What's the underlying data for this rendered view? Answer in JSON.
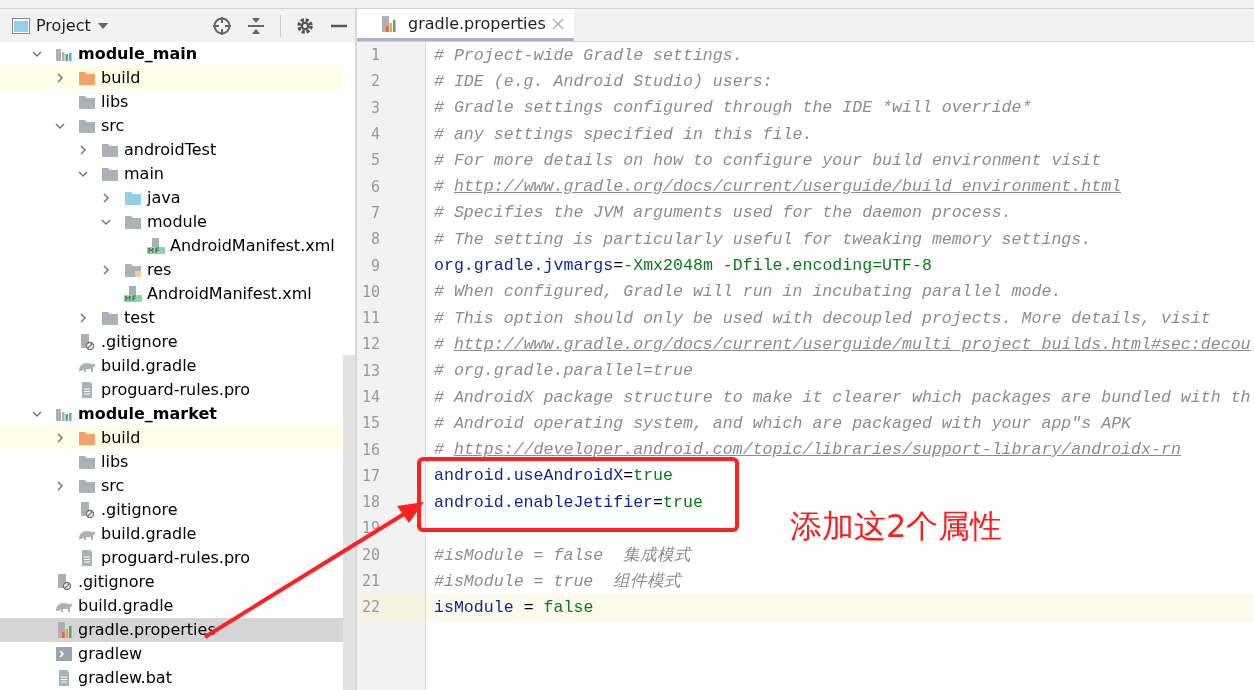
{
  "project_panel": {
    "title": "Project",
    "tree": [
      {
        "label": "module_main",
        "kind": "module",
        "expanded": true,
        "selected": false,
        "children": [
          {
            "label": "build",
            "kind": "excluded-folder",
            "expanded": false,
            "selected": false
          },
          {
            "label": "libs",
            "kind": "folder",
            "selected": false
          },
          {
            "label": "src",
            "kind": "folder",
            "expanded": true,
            "selected": false,
            "children": [
              {
                "label": "androidTest",
                "kind": "folder",
                "expanded": false,
                "selected": false
              },
              {
                "label": "main",
                "kind": "folder",
                "expanded": true,
                "selected": false,
                "children": [
                  {
                    "label": "java",
                    "kind": "source-folder",
                    "expanded": false,
                    "selected": false
                  },
                  {
                    "label": "module",
                    "kind": "folder",
                    "expanded": true,
                    "selected": false,
                    "children": [
                      {
                        "label": "AndroidManifest.xml",
                        "kind": "manifest",
                        "selected": false
                      }
                    ]
                  },
                  {
                    "label": "res",
                    "kind": "res-folder",
                    "expanded": false,
                    "selected": false
                  },
                  {
                    "label": "AndroidManifest.xml",
                    "kind": "manifest",
                    "selected": false
                  }
                ]
              },
              {
                "label": "test",
                "kind": "folder",
                "expanded": false,
                "selected": false
              }
            ]
          },
          {
            "label": ".gitignore",
            "kind": "gitignore",
            "selected": false
          },
          {
            "label": "build.gradle",
            "kind": "gradle",
            "selected": false
          },
          {
            "label": "proguard-rules.pro",
            "kind": "text-file",
            "selected": false
          }
        ]
      },
      {
        "label": "module_market",
        "kind": "module",
        "expanded": true,
        "selected": false,
        "children": [
          {
            "label": "build",
            "kind": "excluded-folder",
            "expanded": false,
            "selected": false
          },
          {
            "label": "libs",
            "kind": "folder",
            "selected": false
          },
          {
            "label": "src",
            "kind": "folder",
            "expanded": false,
            "selected": false
          },
          {
            "label": ".gitignore",
            "kind": "gitignore",
            "selected": false
          },
          {
            "label": "build.gradle",
            "kind": "gradle",
            "selected": false
          },
          {
            "label": "proguard-rules.pro",
            "kind": "text-file",
            "selected": false
          }
        ]
      },
      {
        "label": ".gitignore",
        "kind": "gitignore",
        "selected": false
      },
      {
        "label": "build.gradle",
        "kind": "gradle",
        "selected": false
      },
      {
        "label": "gradle.properties",
        "kind": "properties",
        "selected": true
      },
      {
        "label": "gradlew",
        "kind": "shell",
        "selected": false
      },
      {
        "label": "gradlew.bat",
        "kind": "text-file",
        "selected": false
      }
    ]
  },
  "tabs": [
    {
      "label": "gradle.properties",
      "selected": true
    }
  ],
  "editor": {
    "lines": [
      {
        "number": "1",
        "current": false,
        "segments": [
          {
            "kind": "comment",
            "text": "# Project-wide Gradle settings."
          }
        ]
      },
      {
        "number": "2",
        "current": false,
        "segments": [
          {
            "kind": "comment",
            "text": "# IDE (e.g. Android Studio) users:"
          }
        ]
      },
      {
        "number": "3",
        "current": false,
        "segments": [
          {
            "kind": "comment",
            "text": "# Gradle settings configured through the IDE *will override*"
          }
        ]
      },
      {
        "number": "4",
        "current": false,
        "segments": [
          {
            "kind": "comment",
            "text": "# any settings specified in this file."
          }
        ]
      },
      {
        "number": "5",
        "current": false,
        "segments": [
          {
            "kind": "comment",
            "text": "# For more details on how to configure your build environment visit"
          }
        ]
      },
      {
        "number": "6",
        "current": false,
        "segments": [
          {
            "kind": "comment",
            "text": "# "
          },
          {
            "kind": "link",
            "text": "http://www.gradle.org/docs/current/userguide/build_environment.html"
          }
        ]
      },
      {
        "number": "7",
        "current": false,
        "segments": [
          {
            "kind": "comment",
            "text": "# Specifies the JVM arguments used for the daemon process."
          }
        ]
      },
      {
        "number": "8",
        "current": false,
        "segments": [
          {
            "kind": "comment",
            "text": "# The setting is particularly useful for tweaking memory settings."
          }
        ]
      },
      {
        "number": "9",
        "current": false,
        "segments": [
          {
            "kind": "key",
            "text": "org.gradle.jvmargs"
          },
          {
            "kind": "plain",
            "text": "="
          },
          {
            "kind": "value",
            "text": "-Xmx2048m -Dfile.encoding=UTF-8"
          }
        ]
      },
      {
        "number": "10",
        "current": false,
        "segments": [
          {
            "kind": "comment",
            "text": "# When configured, Gradle will run in incubating parallel mode."
          }
        ]
      },
      {
        "number": "11",
        "current": false,
        "segments": [
          {
            "kind": "comment",
            "text": "# This option should only be used with decoupled projects. More details, visit"
          }
        ]
      },
      {
        "number": "12",
        "current": false,
        "segments": [
          {
            "kind": "comment",
            "text": "# "
          },
          {
            "kind": "link",
            "text": "http://www.gradle.org/docs/current/userguide/multi_project_builds.html#sec:decou"
          }
        ]
      },
      {
        "number": "13",
        "current": false,
        "segments": [
          {
            "kind": "comment",
            "text": "# org.gradle.parallel=true"
          }
        ]
      },
      {
        "number": "14",
        "current": false,
        "segments": [
          {
            "kind": "comment",
            "text": "# AndroidX package structure to make it clearer which packages are bundled with th"
          }
        ]
      },
      {
        "number": "15",
        "current": false,
        "segments": [
          {
            "kind": "comment",
            "text": "# Android operating system, and which are packaged with your app\"s APK"
          }
        ]
      },
      {
        "number": "16",
        "current": false,
        "segments": [
          {
            "kind": "comment",
            "text": "# "
          },
          {
            "kind": "link",
            "text": "https://developer.android.com/topic/libraries/support-library/androidx-rn"
          }
        ]
      },
      {
        "number": "17",
        "current": false,
        "segments": [
          {
            "kind": "key",
            "text": "android.useAndroidX"
          },
          {
            "kind": "plain",
            "text": "="
          },
          {
            "kind": "value",
            "text": "true"
          }
        ]
      },
      {
        "number": "18",
        "current": false,
        "segments": [
          {
            "kind": "key",
            "text": "android.enableJetifier"
          },
          {
            "kind": "plain",
            "text": "="
          },
          {
            "kind": "value",
            "text": "true"
          }
        ]
      },
      {
        "number": "19",
        "current": false
      },
      {
        "number": "20",
        "current": false,
        "segments": [
          {
            "kind": "comment",
            "text": "#isModule = false  集成模式"
          }
        ]
      },
      {
        "number": "21",
        "current": false,
        "segments": [
          {
            "kind": "comment",
            "text": "#isModule = true  组件模式"
          }
        ]
      },
      {
        "number": "22",
        "current": true,
        "segments": [
          {
            "kind": "key",
            "text": "isModule"
          },
          {
            "kind": "plain",
            "text": " = "
          },
          {
            "kind": "value",
            "text": "false"
          }
        ]
      }
    ]
  },
  "annotation": {
    "text": "添加这2个属性"
  }
}
